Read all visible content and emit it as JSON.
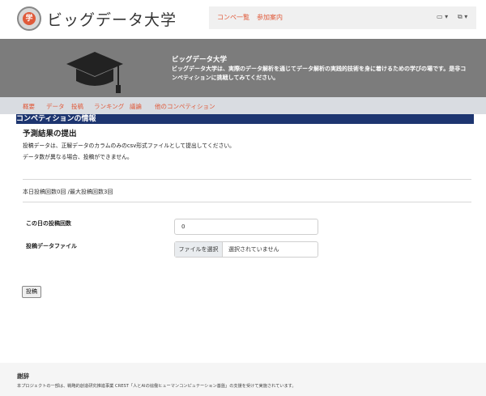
{
  "header": {
    "site_title": "ビッグデータ大学",
    "logo_char": "学",
    "nav": [
      "コンペ一覧",
      "参加案内"
    ],
    "controls": [
      "▭ ▾",
      "⧉ ▾"
    ]
  },
  "hero": {
    "title": "ビッグデータ大学",
    "description": "ビッグデータ大学は、実際のデータ解析を通じてデータ解析の実践的技術を身に着けるための学びの場です。是非コンペティションに挑戦してみてください。"
  },
  "subnav": [
    "概要",
    "データ",
    "投稿",
    "ランキング",
    "議論",
    "他のコンペティション"
  ],
  "section": {
    "banner": "コンペティションの情報",
    "title": "予測結果の提出",
    "desc1": "投稿データは、正解データのカラムのみのcsv形式ファイルとして提出してください。",
    "desc2": "データ数が異なる場合、投稿ができません。",
    "count": "本日投稿回数0回 /最大投稿回数3回"
  },
  "form": {
    "count_label": "この日の投稿回数",
    "count_value": "0",
    "file_label": "投稿データファイル",
    "file_button": "ファイルを選択",
    "file_status": "選択されていません",
    "submit": "投稿"
  },
  "footer": {
    "title": "謝辞",
    "text": "本プロジェクトの一部は、戦略的創造研究推進事業 CREST「人とAIの協働ヒューマンコンピュテーション基盤」の支援を受けて実施されています。"
  },
  "colors": {
    "accent": "#e05a3a",
    "banner": "#1d3570",
    "hero": "#7c7c7c",
    "subnav": "#d9dce1"
  }
}
